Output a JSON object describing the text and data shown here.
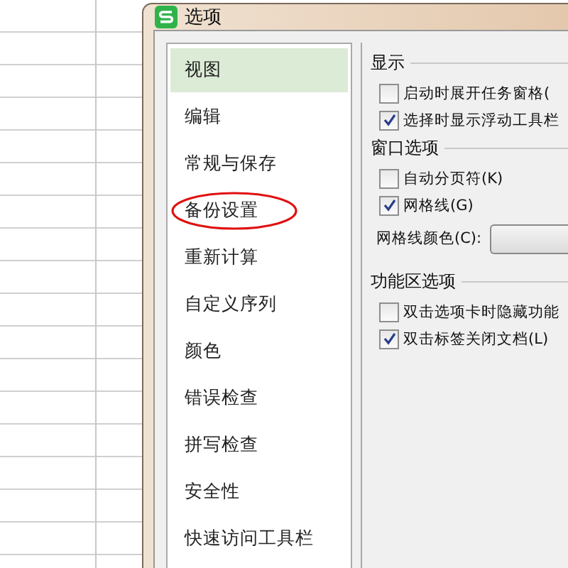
{
  "window": {
    "title": "选项"
  },
  "sidebar": {
    "items": [
      {
        "label": "视图",
        "selected": true,
        "circled": false
      },
      {
        "label": "编辑",
        "selected": false,
        "circled": false
      },
      {
        "label": "常规与保存",
        "selected": false,
        "circled": false
      },
      {
        "label": "备份设置",
        "selected": false,
        "circled": true
      },
      {
        "label": "重新计算",
        "selected": false,
        "circled": false
      },
      {
        "label": "自定义序列",
        "selected": false,
        "circled": false
      },
      {
        "label": "颜色",
        "selected": false,
        "circled": false
      },
      {
        "label": "错误检查",
        "selected": false,
        "circled": false
      },
      {
        "label": "拼写检查",
        "selected": false,
        "circled": false
      },
      {
        "label": "安全性",
        "selected": false,
        "circled": false
      },
      {
        "label": "快速访问工具栏",
        "selected": false,
        "circled": false
      }
    ]
  },
  "sections": [
    {
      "title": "显示",
      "options": [
        {
          "kind": "checkbox",
          "label": "启动时展开任务窗格(",
          "checked": false
        },
        {
          "kind": "checkbox",
          "label": "选择时显示浮动工具栏",
          "checked": true
        }
      ]
    },
    {
      "title": "窗口选项",
      "options": [
        {
          "kind": "checkbox",
          "label": "自动分页符(K)",
          "checked": false
        },
        {
          "kind": "checkbox",
          "label": "网格线(G)",
          "checked": true
        },
        {
          "kind": "color",
          "label": "网格线颜色(C):"
        }
      ]
    },
    {
      "title": "功能区选项",
      "options": [
        {
          "kind": "checkbox",
          "label": "双击选项卡时隐藏功能",
          "checked": false
        },
        {
          "kind": "checkbox",
          "label": "双击标签关闭文档(L)",
          "checked": true
        }
      ]
    }
  ]
}
